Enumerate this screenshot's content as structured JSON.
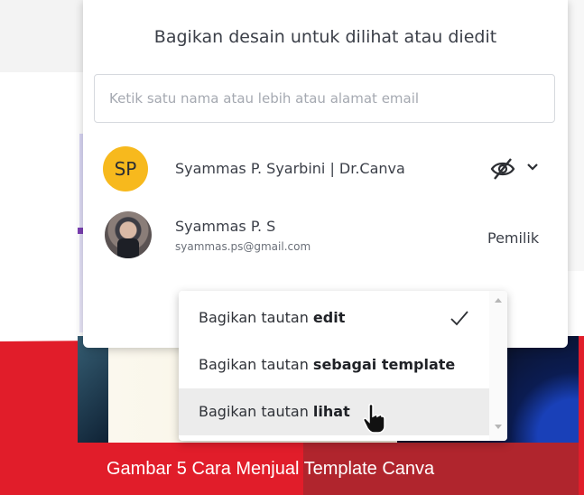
{
  "dialog": {
    "title": "Bagikan desain untuk dilihat atau diedit",
    "search_placeholder": "Ketik satu nama atau lebih atau alamat email",
    "search_value": ""
  },
  "collaborators": [
    {
      "initials": "SP",
      "name": "Syammas P. Syarbini | Dr.Canva",
      "permission_icon": "eye-slash-icon",
      "avatar_color": "#f7b91d"
    },
    {
      "name": "Syammas P. S",
      "email": "syammas.ps@gmail.com",
      "role": "Pemilik"
    }
  ],
  "share_menu": {
    "items": [
      {
        "prefix": "Bagikan tautan ",
        "bold": "edit",
        "selected": true
      },
      {
        "prefix": "Bagikan tautan ",
        "bold": "sebagai template",
        "selected": false
      },
      {
        "prefix": "Bagikan tautan ",
        "bold": "lihat",
        "selected": false,
        "hovered": true
      }
    ]
  },
  "caption": "Gambar 5 Cara Menjual Template Canva",
  "colors": {
    "banner_red": "#e11d2a",
    "banner_dark_red": "#b0252d",
    "avatar_yellow": "#f7b91d"
  }
}
